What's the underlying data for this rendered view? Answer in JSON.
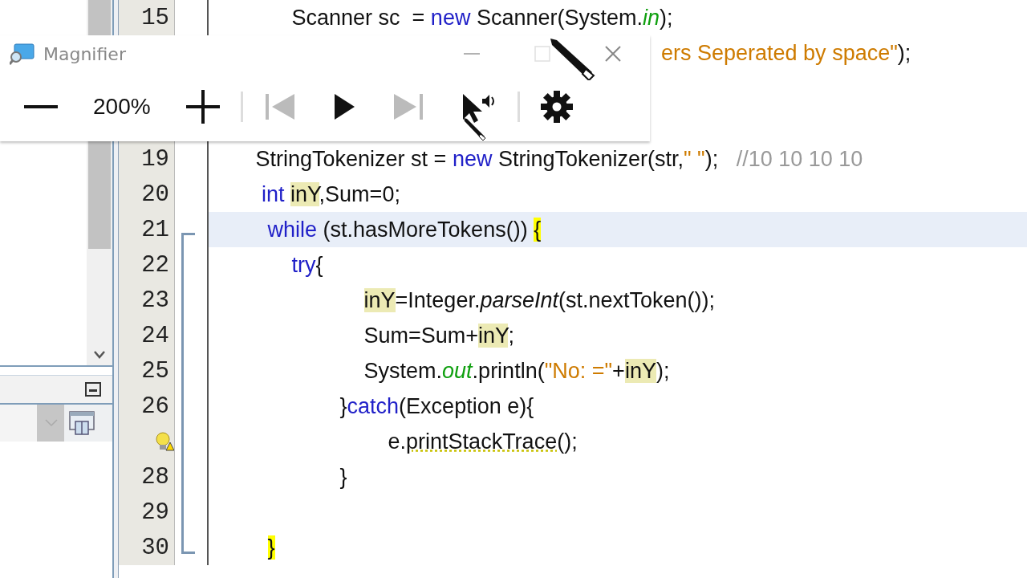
{
  "magnifier": {
    "title": "Magnifier",
    "maximize_disabled": true,
    "zoom_level": "200%",
    "previous_disabled": true,
    "next_disabled": true
  },
  "left_panel": {
    "combo_disabled": true
  },
  "editor": {
    "lines": [
      {
        "number": "15",
        "kind": "code",
        "current": false,
        "tokens": [
          {
            "kind": "plain",
            "text": "         Scanner sc  = "
          },
          {
            "kind": "keyword",
            "text": "new"
          },
          {
            "kind": "plain",
            "text": " Scanner(System."
          },
          {
            "kind": "static",
            "text": "in"
          },
          {
            "kind": "plain",
            "text": ");"
          }
        ]
      },
      {
        "kind": "partial",
        "current": false,
        "tokens": [
          {
            "kind": "string",
            "text": "ers Seperated by space\""
          },
          {
            "kind": "plain",
            "text": ");"
          }
        ]
      },
      {
        "kind": "hidden"
      },
      {
        "kind": "hidden"
      },
      {
        "number": "19",
        "kind": "code",
        "current": false,
        "tokens": [
          {
            "kind": "plain",
            "text": "   StringTokenizer st = "
          },
          {
            "kind": "keyword",
            "text": "new"
          },
          {
            "kind": "plain",
            "text": " StringTokenizer(str,"
          },
          {
            "kind": "string",
            "text": "\" \""
          },
          {
            "kind": "plain",
            "text": ");   "
          },
          {
            "kind": "comment",
            "text": "//10 10 10 10"
          }
        ]
      },
      {
        "number": "20",
        "kind": "code",
        "current": false,
        "tokens": [
          {
            "kind": "keyword",
            "text": "    int "
          },
          {
            "kind": "occurrence",
            "text": "inY"
          },
          {
            "kind": "plain",
            "text": ",Sum=0;"
          }
        ]
      },
      {
        "number": "21",
        "kind": "code",
        "current": true,
        "tokens": [
          {
            "kind": "keyword",
            "text": "     while"
          },
          {
            "kind": "plain",
            "text": " (st.hasMoreTokens()) "
          },
          {
            "kind": "brace",
            "text": "{"
          }
        ]
      },
      {
        "number": "22",
        "kind": "code",
        "current": false,
        "tokens": [
          {
            "kind": "keyword",
            "text": "         try"
          },
          {
            "kind": "plain",
            "text": "{"
          }
        ]
      },
      {
        "number": "23",
        "kind": "code",
        "current": false,
        "tokens": [
          {
            "kind": "occurrence",
            "text": "                     inY"
          },
          {
            "kind": "plain",
            "text": "=Integer."
          },
          {
            "kind": "method",
            "text": "parseInt"
          },
          {
            "kind": "plain",
            "text": "(st.nextToken());"
          }
        ]
      },
      {
        "number": "24",
        "kind": "code",
        "current": false,
        "tokens": [
          {
            "kind": "plain",
            "text": "                     Sum=Sum+"
          },
          {
            "kind": "occurrence",
            "text": "inY"
          },
          {
            "kind": "plain",
            "text": ";"
          }
        ]
      },
      {
        "number": "25",
        "kind": "code",
        "current": false,
        "tokens": [
          {
            "kind": "plain",
            "text": "                     System."
          },
          {
            "kind": "static",
            "text": "out"
          },
          {
            "kind": "plain",
            "text": ".println("
          },
          {
            "kind": "string",
            "text": "\"No: =\""
          },
          {
            "kind": "plain",
            "text": "+"
          },
          {
            "kind": "occurrence",
            "text": "inY"
          },
          {
            "kind": "plain",
            "text": ");"
          }
        ]
      },
      {
        "number": "26",
        "kind": "code",
        "current": false,
        "tokens": [
          {
            "kind": "plain",
            "text": "                 }"
          },
          {
            "kind": "keyword",
            "text": "catch"
          },
          {
            "kind": "plain",
            "text": "(Exception e){"
          }
        ]
      },
      {
        "kind": "warning",
        "current": false,
        "tokens": [
          {
            "kind": "plain",
            "text": "                         e."
          },
          {
            "kind": "warned",
            "text": "printStackTrace"
          },
          {
            "kind": "plain",
            "text": "();"
          }
        ]
      },
      {
        "number": "28",
        "kind": "code",
        "current": false,
        "tokens": [
          {
            "kind": "plain",
            "text": "                 }"
          }
        ]
      },
      {
        "number": "29",
        "kind": "code",
        "current": false
      },
      {
        "number": "30",
        "kind": "code",
        "current": false,
        "tokens": [
          {
            "kind": "brace",
            "text": "     }"
          }
        ]
      }
    ]
  }
}
